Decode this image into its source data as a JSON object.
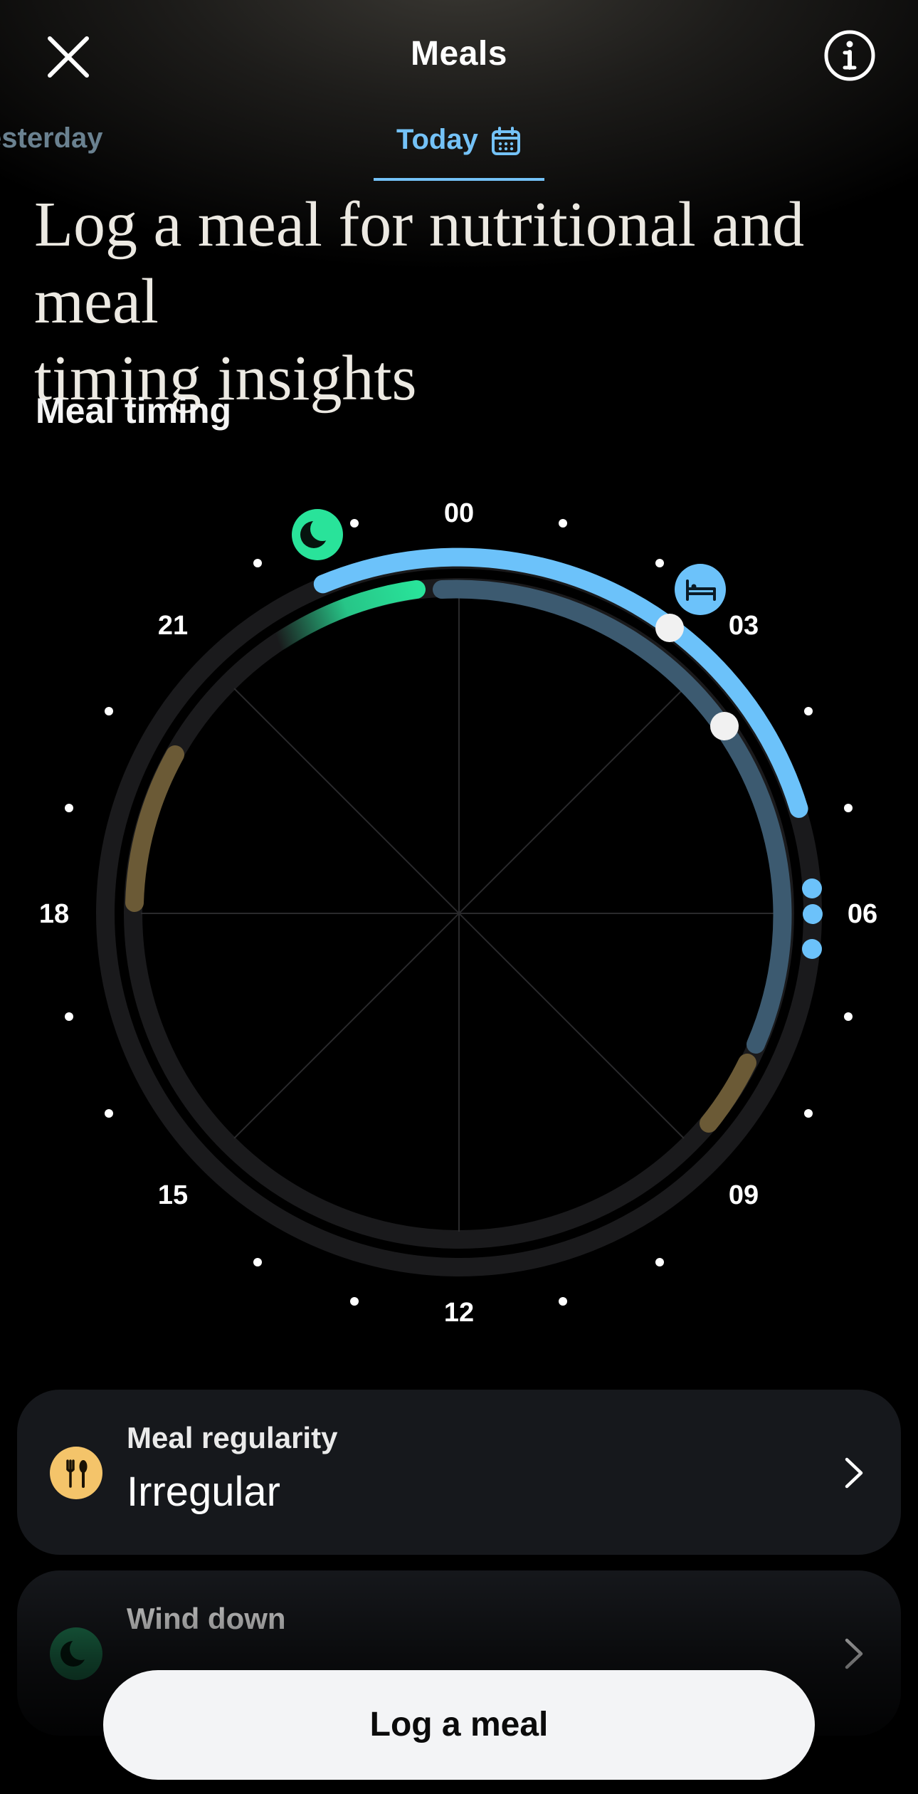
{
  "header": {
    "title": "Meals",
    "close_icon": "close-icon",
    "info_icon": "info-icon"
  },
  "day_tabs": {
    "previous": "esterday",
    "current": "Today",
    "current_icon": "calendar-icon"
  },
  "headline": {
    "line1": "Log a meal for nutritional and meal",
    "line2": "timing insights"
  },
  "meal_timing": {
    "title": "Meal timing",
    "hour_labels": [
      "00",
      "03",
      "06",
      "09",
      "12",
      "15",
      "18",
      "21"
    ],
    "icons": [
      "moon-icon",
      "bed-icon"
    ],
    "colors": {
      "sleep": "#6cc2fa",
      "sleep_dim": "#3c5a70",
      "wind_down": "#29e39a",
      "meal": "#6b5a36",
      "ring": "#1a1a1c"
    }
  },
  "cards": {
    "regularity": {
      "label": "Meal regularity",
      "value": "Irregular",
      "icon": "fork-knife-icon",
      "icon_color": "#f4c46a"
    },
    "wind_down": {
      "label": "Wind down",
      "icon": "moon-icon",
      "icon_color": "#1f7a52"
    }
  },
  "actions": {
    "log_meal": "Log a meal"
  }
}
